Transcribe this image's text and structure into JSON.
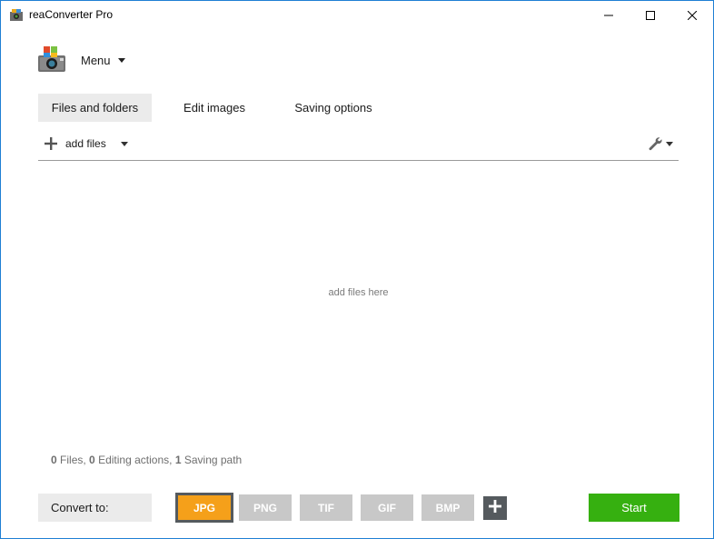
{
  "window": {
    "title": "reaConverter Pro",
    "accent_color": "#1f7fd4",
    "controls": [
      "minimize-icon",
      "maximize-icon",
      "close-icon"
    ]
  },
  "menu": {
    "label": "Menu",
    "icon": "app-logo-icon"
  },
  "tabs": [
    {
      "label": "Files and folders",
      "active": true
    },
    {
      "label": "Edit images",
      "active": false
    },
    {
      "label": "Saving options",
      "active": false
    }
  ],
  "toolbar": {
    "add_files_label": "add files",
    "add_icon": "plus-icon",
    "settings_icon": "wrench-icon"
  },
  "drop_area": {
    "hint": "add files here"
  },
  "status": {
    "files_count": "0",
    "files_label": "Files,",
    "editing_count": "0",
    "editing_label": "Editing actions,",
    "saving_count": "1",
    "saving_label": "Saving path"
  },
  "convert": {
    "label": "Convert to:",
    "formats": [
      {
        "label": "JPG",
        "selected": true
      },
      {
        "label": "PNG",
        "selected": false
      },
      {
        "label": "TIF",
        "selected": false
      },
      {
        "label": "GIF",
        "selected": false
      },
      {
        "label": "BMP",
        "selected": false
      }
    ],
    "add_format_icon": "plus-icon",
    "selected_color": "#f5a01a",
    "inactive_color": "#c8c8c8"
  },
  "start": {
    "label": "Start",
    "color": "#36b010"
  }
}
